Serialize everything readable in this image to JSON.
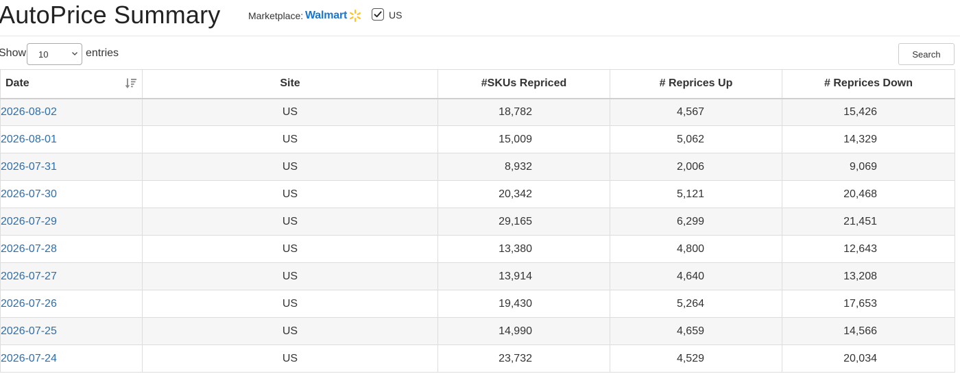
{
  "header": {
    "title": "AutoPrice Summary",
    "marketplace_label": "Marketplace:",
    "marketplace_name": "Walmart",
    "region_checked": true,
    "region_label": "US"
  },
  "controls": {
    "show_label": "Show",
    "page_size": "10",
    "entries_label": "entries",
    "search_label": "Search"
  },
  "table": {
    "columns": [
      "Date",
      "Site",
      "#SKUs Repriced",
      "# Reprices Up",
      "# Reprices Down"
    ],
    "sort": {
      "column": "Date",
      "direction": "descending"
    },
    "rows": [
      {
        "date": "2026-08-02",
        "site": "US",
        "skus": "18,782",
        "up": "4,567",
        "down": "15,426"
      },
      {
        "date": "2026-08-01",
        "site": "US",
        "skus": "15,009",
        "up": "5,062",
        "down": "14,329"
      },
      {
        "date": "2026-07-31",
        "site": "US",
        "skus": "8,932",
        "up": "2,006",
        "down": "9,069"
      },
      {
        "date": "2026-07-30",
        "site": "US",
        "skus": "20,342",
        "up": "5,121",
        "down": "20,468"
      },
      {
        "date": "2026-07-29",
        "site": "US",
        "skus": "29,165",
        "up": "6,299",
        "down": "21,451"
      },
      {
        "date": "2026-07-28",
        "site": "US",
        "skus": "13,380",
        "up": "4,800",
        "down": "12,643"
      },
      {
        "date": "2026-07-27",
        "site": "US",
        "skus": "13,914",
        "up": "4,640",
        "down": "13,208"
      },
      {
        "date": "2026-07-26",
        "site": "US",
        "skus": "19,430",
        "up": "5,264",
        "down": "17,653"
      },
      {
        "date": "2026-07-25",
        "site": "US",
        "skus": "14,990",
        "up": "4,659",
        "down": "14,566"
      },
      {
        "date": "2026-07-24",
        "site": "US",
        "skus": "23,732",
        "up": "4,529",
        "down": "20,034"
      }
    ]
  },
  "colors": {
    "link": "#2a6fb0",
    "walmart_blue": "#1a75cf",
    "walmart_yellow": "#ffc220",
    "row_stripe": "#f6f6f6"
  },
  "icons": {
    "sort": "sort-descending-icon",
    "logo": "walmart-spark-icon",
    "check": "checkmark-icon",
    "dropdown": "chevron-down-icon"
  }
}
